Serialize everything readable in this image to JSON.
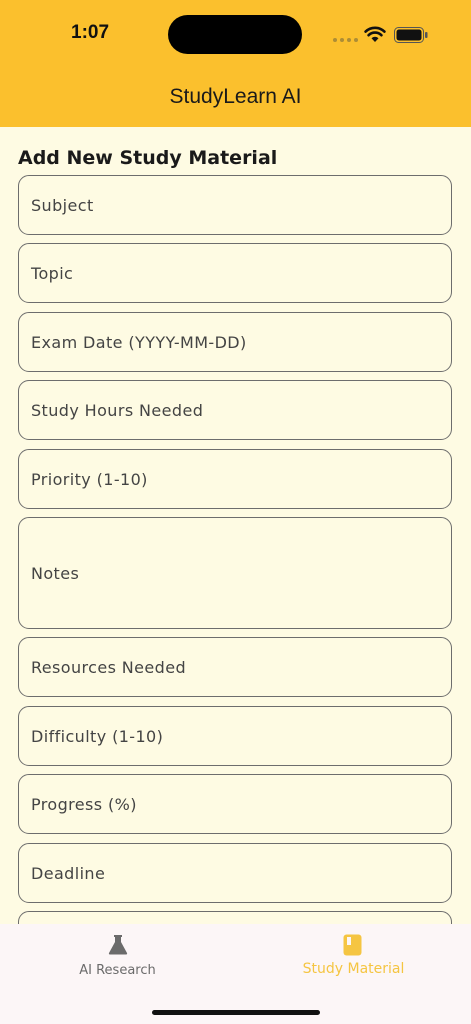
{
  "status_bar": {
    "time": "1:07"
  },
  "header": {
    "title": "StudyLearn AI"
  },
  "form": {
    "heading": "Add New Study Material",
    "fields": [
      {
        "name": "subject",
        "placeholder": "Subject"
      },
      {
        "name": "topic",
        "placeholder": "Topic"
      },
      {
        "name": "exam-date",
        "placeholder": "Exam Date (YYYY-MM-DD)"
      },
      {
        "name": "study-hours",
        "placeholder": "Study Hours Needed"
      },
      {
        "name": "priority",
        "placeholder": "Priority (1-10)"
      },
      {
        "name": "notes",
        "placeholder": "Notes"
      },
      {
        "name": "resources",
        "placeholder": "Resources Needed"
      },
      {
        "name": "difficulty",
        "placeholder": "Difficulty (1-10)"
      },
      {
        "name": "progress",
        "placeholder": "Progress (%)"
      },
      {
        "name": "deadline",
        "placeholder": "Deadline"
      }
    ]
  },
  "tabbar": {
    "tabs": [
      {
        "label": "AI Research",
        "icon": "flask-icon",
        "active": false
      },
      {
        "label": "Study Material",
        "icon": "book-icon",
        "active": true
      }
    ]
  },
  "colors": {
    "accent": "#FBC02D",
    "background": "#FEFBE3",
    "tab_active": "#F5C542",
    "tab_inactive": "#6b6b6b"
  }
}
